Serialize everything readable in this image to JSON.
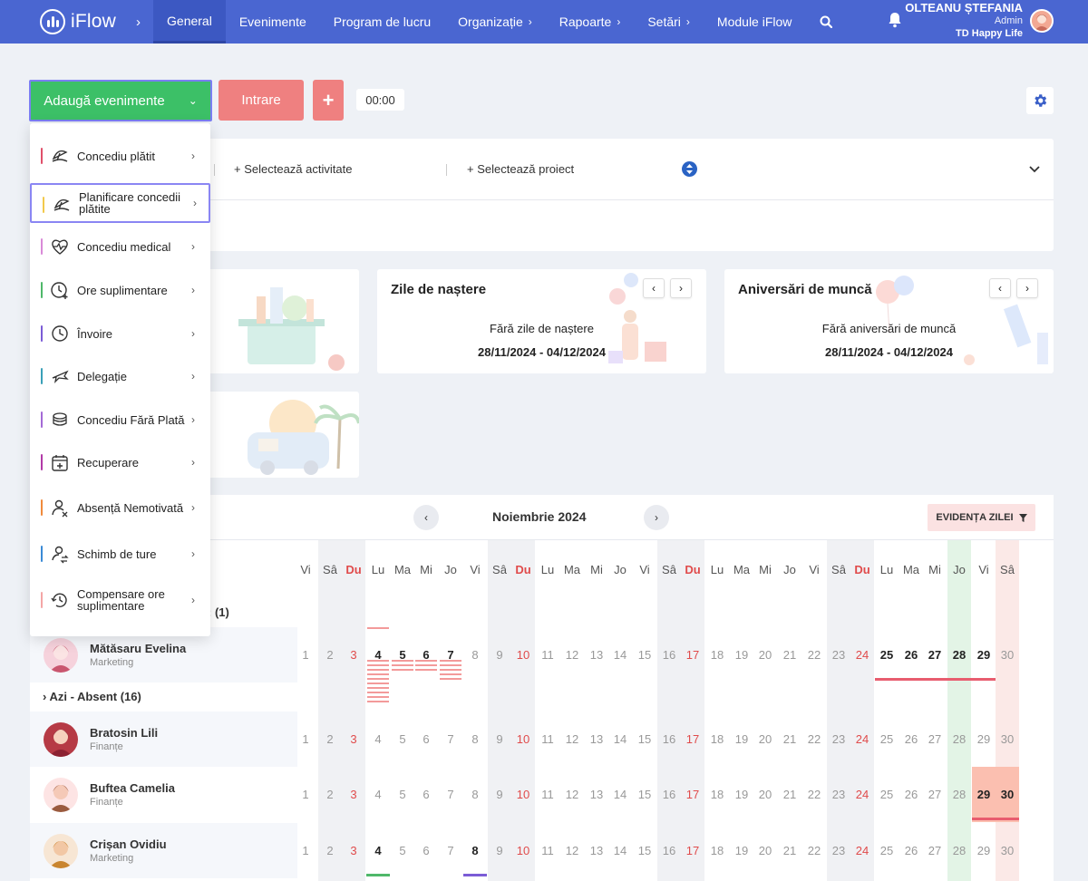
{
  "nav": {
    "logo": "iFlow",
    "items": [
      {
        "label": "General",
        "active": true,
        "chev": false
      },
      {
        "label": "Evenimente",
        "active": false,
        "chev": false
      },
      {
        "label": "Program de lucru",
        "active": false,
        "chev": false
      },
      {
        "label": "Organizație",
        "active": false,
        "chev": true
      },
      {
        "label": "Rapoarte",
        "active": false,
        "chev": true
      },
      {
        "label": "Setări",
        "active": false,
        "chev": true
      },
      {
        "label": "Module iFlow",
        "active": false,
        "chev": false
      }
    ],
    "user_name": "OLTEANU ȘTEFANIA",
    "user_role": "Admin",
    "company": "TD Happy Life"
  },
  "toolbar": {
    "add_label": "Adaugă evenimente",
    "intrare_label": "Intrare",
    "plus_label": "+",
    "timer": "00:00"
  },
  "selectors": {
    "activity": "+ Selectează activitate",
    "project": "+ Selectează proiect"
  },
  "cards": {
    "birthdays": {
      "title": "Zile de naștere",
      "empty": "Fără zile de naștere",
      "range": "28/11/2024 - 04/12/2024"
    },
    "anniversaries": {
      "title": "Aniversări de muncă",
      "empty": "Fără aniversări de muncă",
      "range": "28/11/2024 - 04/12/2024"
    }
  },
  "dropdown": {
    "items": [
      {
        "label": "Concediu plătit",
        "color": "#e0506a",
        "icon": "beach-umbrella-icon"
      },
      {
        "label": "Planificare concedii plătite",
        "color": "#f2c94c",
        "icon": "beach-umbrella-icon",
        "selected": true
      },
      {
        "label": "Concediu medical",
        "color": "#d98ad8",
        "icon": "heart-pulse-icon"
      },
      {
        "label": "Ore suplimentare",
        "color": "#4fb86a",
        "icon": "clock-plus-icon"
      },
      {
        "label": "Învoire",
        "color": "#7b5cd6",
        "icon": "clock-icon"
      },
      {
        "label": "Delegație",
        "color": "#3aa0b8",
        "icon": "plane-icon"
      },
      {
        "label": "Concediu Fără Plată",
        "color": "#a46ad6",
        "icon": "coins-icon"
      },
      {
        "label": "Recuperare",
        "color": "#b23aa8",
        "icon": "calendar-plus-icon"
      },
      {
        "label": "Absență Nemotivată",
        "color": "#f08a3c",
        "icon": "user-x-icon"
      },
      {
        "label": "Schimb de ture",
        "color": "#3a8ad6",
        "icon": "user-swap-icon"
      },
      {
        "label": "Compensare ore suplimentare",
        "color": "#f4a6a6",
        "icon": "clock-refresh-icon"
      }
    ]
  },
  "calendar": {
    "month": "Noiembrie 2024",
    "evidenta_label": "EVIDENȚA ZILEI",
    "weekdays": [
      "Vi",
      "Sâ",
      "Du",
      "Lu",
      "Ma",
      "Mi",
      "Jo",
      "Vi",
      "Sâ",
      "Du",
      "Lu",
      "Ma",
      "Mi",
      "Jo",
      "Vi",
      "Sâ",
      "Du",
      "Lu",
      "Ma",
      "Mi",
      "Jo",
      "Vi",
      "Sâ",
      "Du",
      "Lu",
      "Ma",
      "Mi",
      "Jo",
      "Vi",
      "Sâ"
    ],
    "group1_label": ": (1)",
    "group2_label": "Azi - Absent (16)",
    "employees": [
      {
        "name": "Mătăsaru Evelina",
        "dept": "Marketing"
      },
      {
        "name": "Bratosin Lili",
        "dept": "Finanțe"
      },
      {
        "name": "Buftea Camelia",
        "dept": "Finanțe"
      },
      {
        "name": "Crișan Ovidiu",
        "dept": "Marketing"
      }
    ]
  },
  "colors": {
    "accent": "#4a66d1",
    "add_button": "#3cc067",
    "intrare": "#ef8080",
    "today_column": "#e3f4e6",
    "weekend_column": "#f0f1f4",
    "last_saturday": "#fbe9e7",
    "absence_highlight": "#fbbfb0"
  }
}
